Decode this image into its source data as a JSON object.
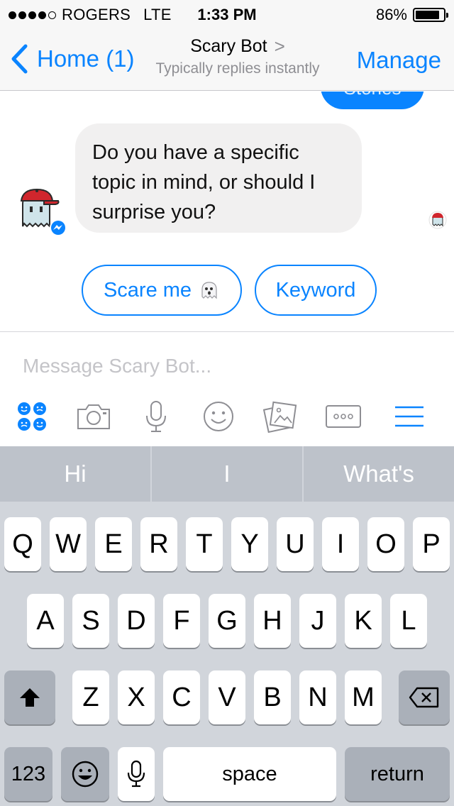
{
  "status_bar": {
    "carrier": "ROGERS",
    "network": "LTE",
    "time": "1:33 PM",
    "battery_percent": "86%",
    "battery_level": 0.86,
    "signal_bars_filled": 4,
    "signal_bars_total": 5
  },
  "nav": {
    "back_label": "Home (1)",
    "title": "Scary Bot",
    "title_chevron": ">",
    "subtitle": "Typically replies instantly",
    "manage_label": "Manage"
  },
  "conversation": {
    "previous_bubble_text": "Stories",
    "bot_message": "Do you have a specific topic in mind, or should I surprise you?",
    "quick_replies": [
      {
        "label": "Scare me",
        "icon": "ghost-emoji"
      },
      {
        "label": "Keyword"
      }
    ]
  },
  "composer": {
    "placeholder": "Message Scary Bot...",
    "tools": [
      "apps-icon",
      "camera-icon",
      "microphone-icon",
      "smiley-icon",
      "gallery-icon",
      "more-icon",
      "menu-icon"
    ]
  },
  "keyboard": {
    "suggestions": [
      "Hi",
      "I",
      "What's"
    ],
    "row1": [
      "Q",
      "W",
      "E",
      "R",
      "T",
      "Y",
      "U",
      "I",
      "O",
      "P"
    ],
    "row2": [
      "A",
      "S",
      "D",
      "F",
      "G",
      "H",
      "J",
      "K",
      "L"
    ],
    "row3": [
      "Z",
      "X",
      "C",
      "V",
      "B",
      "N",
      "M"
    ],
    "numbers_label": "123",
    "space_label": "space",
    "return_label": "return"
  },
  "colors": {
    "accent": "#0a84ff",
    "bubble_gray": "#f1f0f0",
    "keyboard_bg": "#d1d5db",
    "suggestion_bg": "#bdc2ca"
  }
}
